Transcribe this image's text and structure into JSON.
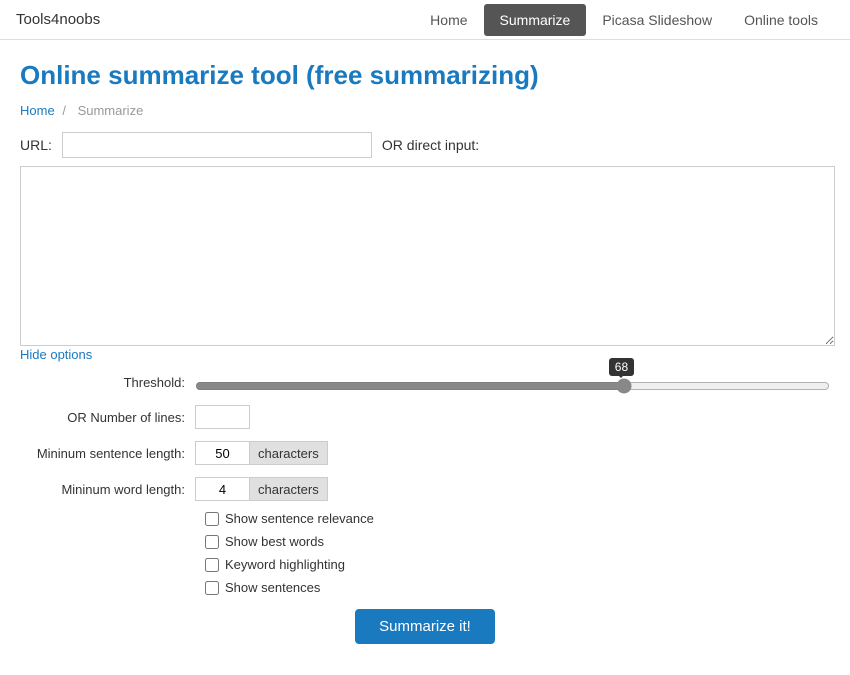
{
  "nav": {
    "logo": "Tools4noobs",
    "links": [
      {
        "label": "Home",
        "active": false
      },
      {
        "label": "Summarize",
        "active": true
      },
      {
        "label": "Picasa Slideshow",
        "active": false
      },
      {
        "label": "Online tools",
        "active": false
      }
    ]
  },
  "page": {
    "title": "Online summarize tool (free summarizing)",
    "breadcrumb_home": "Home",
    "breadcrumb_separator": "/",
    "breadcrumb_current": "Summarize",
    "url_label": "URL:",
    "url_placeholder": "",
    "or_direct_label": "OR direct input:",
    "textarea_placeholder": "",
    "hide_options_label": "Hide options",
    "threshold_label": "Threshold:",
    "threshold_value": 68,
    "or_number_of_lines_label": "OR Number of lines:",
    "min_sentence_length_label": "Mininum sentence length:",
    "min_sentence_length_value": "50",
    "min_sentence_suffix": "characters",
    "min_word_length_label": "Mininum word length:",
    "min_word_length_value": "4",
    "min_word_suffix": "characters",
    "checkboxes": [
      {
        "id": "chk_relevance",
        "label": "Show sentence relevance",
        "checked": false
      },
      {
        "id": "chk_bestwords",
        "label": "Show best words",
        "checked": false
      },
      {
        "id": "chk_keyword",
        "label": "Keyword highlighting",
        "checked": false
      },
      {
        "id": "chk_sentences",
        "label": "Show sentences",
        "checked": false
      }
    ],
    "summarize_button": "Summarize it!"
  }
}
